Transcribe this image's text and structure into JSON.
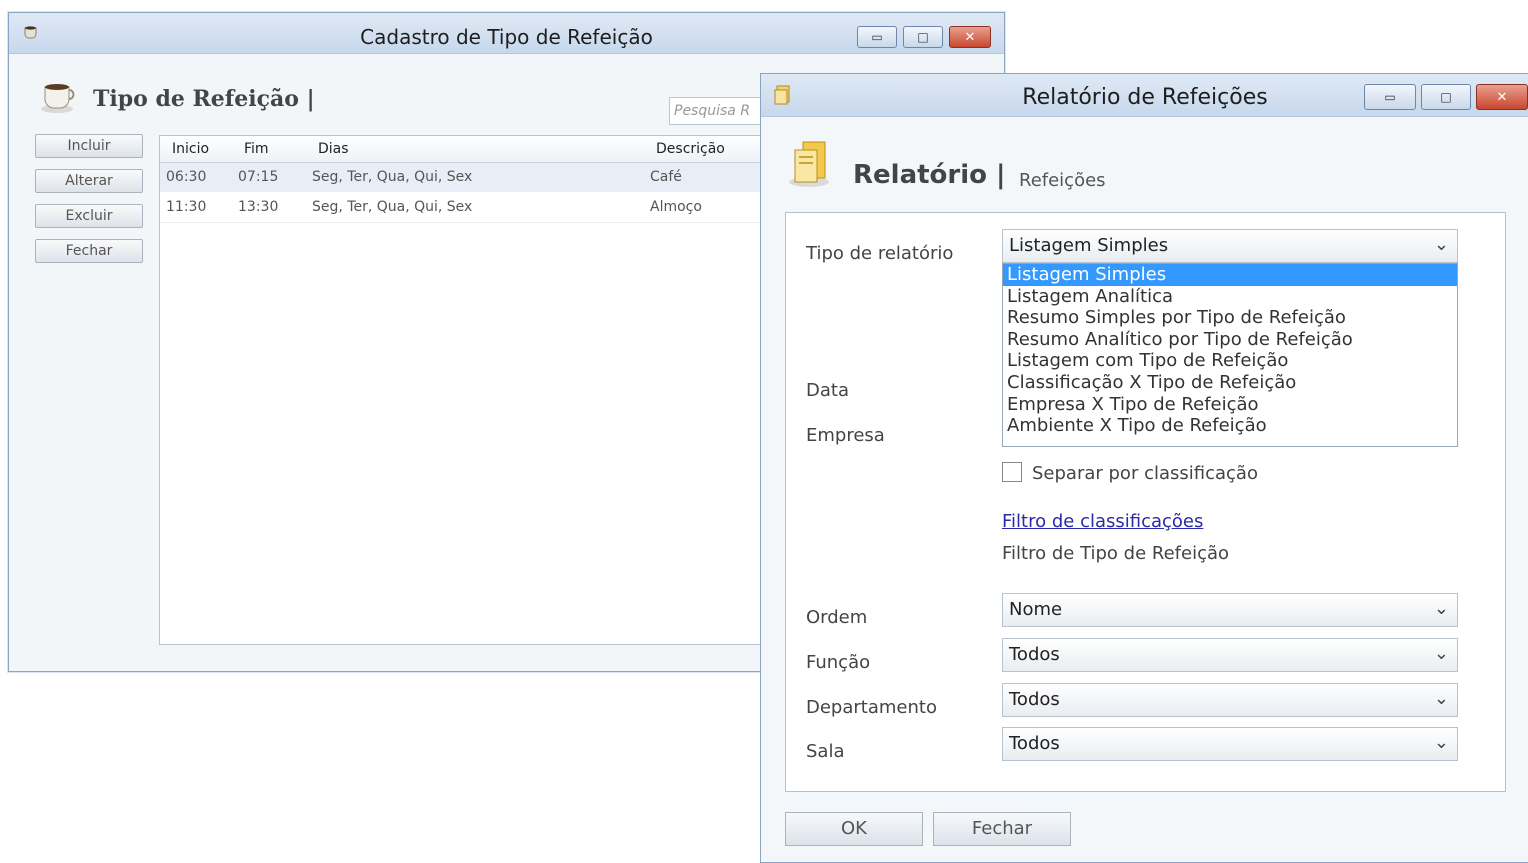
{
  "win1": {
    "title": "Cadastro de Tipo de Refeição",
    "header_title": "Tipo de Refeição |",
    "search_placeholder": "Pesquisa R",
    "buttons": [
      "Incluir",
      "Alterar",
      "Excluir",
      "Fechar"
    ],
    "columns": [
      "Inicio",
      "Fim",
      "Dias",
      "Descrição"
    ],
    "rows": [
      [
        "06:30",
        "07:15",
        "Seg, Ter, Qua, Qui, Sex",
        "Café"
      ],
      [
        "11:30",
        "13:30",
        "Seg, Ter, Qua, Qui, Sex",
        "Almoço"
      ]
    ]
  },
  "win2": {
    "title": "Relatório de Refeições",
    "header_title": "Relatório |",
    "header_subtitle": "Refeições",
    "labels": {
      "tipo": "Tipo de relatório",
      "data": "Data",
      "empresa": "Empresa",
      "ordem": "Ordem",
      "funcao": "Função",
      "departamento": "Departamento",
      "sala": "Sala"
    },
    "tipo_selected": "Listagem Simples",
    "tipo_options": [
      "Listagem Simples",
      "Listagem Analítica",
      "Resumo Simples por Tipo de Refeição",
      "Resumo Analítico por Tipo de Refeição",
      "Listagem com Tipo de Refeição",
      "Classificação X Tipo de Refeição",
      "Empresa X Tipo de Refeição",
      "Ambiente X Tipo de Refeição"
    ],
    "separar_label": "Separar por classificação",
    "separar_checked": false,
    "filtro_link": "Filtro de classificações",
    "filtro_text": "Filtro de Tipo de Refeição",
    "ordem_value": "Nome",
    "funcao_value": "Todos",
    "departamento_value": "Todos",
    "sala_value": "Todos",
    "ok_label": "OK",
    "fechar_label": "Fechar"
  },
  "window_controls": {
    "minimize": "▭",
    "maximize": "□",
    "close": "✕"
  },
  "chevron": "⌄",
  "colors": {
    "selection": "#3399ff",
    "link": "#2a2aa8",
    "close_button": "#c8472f"
  }
}
